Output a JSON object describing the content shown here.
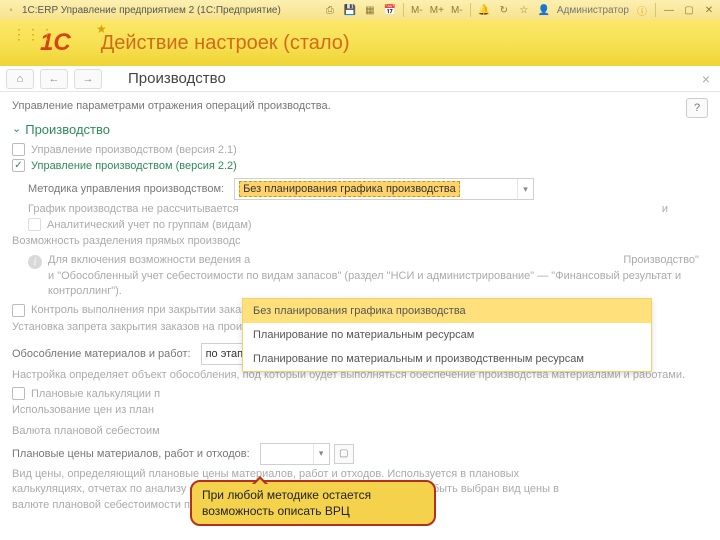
{
  "titlebar": {
    "app_title": "1С:ERP Управление предприятием 2  (1С:Предприятие)",
    "user_label": "Администратор",
    "zoom1": "M-",
    "zoom2": "M+",
    "zoom3": "M-"
  },
  "band": {
    "logo": "1C",
    "title": "Действие настроек (стало)"
  },
  "nav": {
    "title": "Производство"
  },
  "help": "?",
  "content": {
    "description": "Управление параметрами отражения операций производства.",
    "section_title": "Производство",
    "cb_v21": "Управление производством (версия 2.1)",
    "cb_v22": "Управление производством (версия 2.2)",
    "method_label": "Методика управления производством:",
    "method_value": "Без планирования графика производства",
    "method_hint": "График производства не рассчитывается",
    "method_hint_tail": "и",
    "cb_analytic": "Аналитический учет по группам (видам)",
    "analytic_hint": "Возможность разделения прямых производс",
    "info_text_1": "Для включения возможности ведения а",
    "info_text_2": "Производство\" и \"Обособленный учет себестоимости по видам запасов\" (раздел \"НСИ и администрирование\" — \"Финансовый результат и контроллинг\").",
    "cb_control": "Контроль выполнения при закрытии заказов на производство",
    "control_hint": "Установка запрета закрытия заказов на производство, выполненных не полностью.",
    "isolation_label": "Обособление материалов и работ:",
    "isolation_value": "по этапу производства",
    "isolation_hint": "Настройка определяет объект обособления, под который будет выполняться обеспечение производства материалами и работами.",
    "cb_plan_calc": "Плановые калькуляции п",
    "plan_calc_hint": "Использование цен из план",
    "currency_label": "Валюта плановой себестоим",
    "prices_label": "Плановые цены материалов, работ и отходов:",
    "prices_hint": "Вид цены, определяющий плановые цены материалов, работ и отходов. Используется в плановых калькуляциях, отчетах по анализу себестоимости выпущенной продукции. Может быть выбран вид цены в валюте плановой себестоимости продукции."
  },
  "dropdown": {
    "items": [
      "Без планирования графика производства",
      "Планирование по материальным ресурсам",
      "Планирование по материальным и производственным ресурсам"
    ]
  },
  "callout": "При любой методике остается возможность описать ВРЦ"
}
